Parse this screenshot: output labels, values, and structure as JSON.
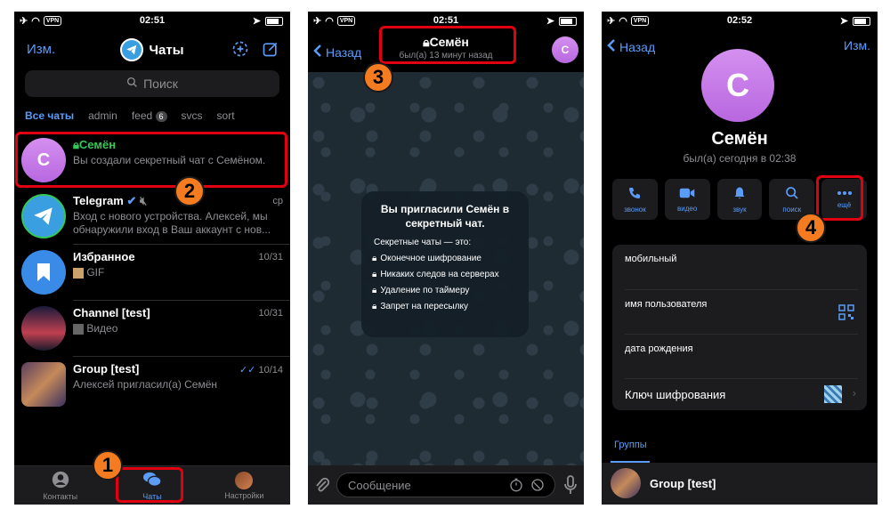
{
  "screens": [
    {
      "status": {
        "time": "02:51",
        "vpn": "VPN"
      },
      "header": {
        "edit_label": "Изм.",
        "title": "Чаты"
      },
      "search": {
        "placeholder": "Поиск"
      },
      "folders": [
        {
          "label": "Все чаты"
        },
        {
          "label": "admin"
        },
        {
          "label": "feed",
          "badge": "6"
        },
        {
          "label": "svcs"
        },
        {
          "label": "sort"
        }
      ],
      "chats": [
        {
          "name": "Семён",
          "date": "",
          "message": "Вы создали секретный чат с Семёном.",
          "avatar_letter": "С",
          "secret": true
        },
        {
          "name": "Telegram",
          "date": "ср",
          "message": "Вход с нового устройства. Алексей, мы обнаружили вход в Ваш аккаунт с нов...",
          "avatar_letter": "",
          "secret": false
        },
        {
          "name": "Избранное",
          "date": "10/31",
          "message": "GIF",
          "avatar_letter": "",
          "secret": false
        },
        {
          "name": "Channel [test]",
          "date": "10/31",
          "message": "Видео",
          "avatar_letter": "",
          "secret": false
        },
        {
          "name": "Group [test]",
          "date": "10/14",
          "message": "Алексей пригласил(а) Семён",
          "avatar_letter": "",
          "secret": false
        }
      ],
      "tabs": [
        {
          "label": "Контакты"
        },
        {
          "label": "Чаты"
        },
        {
          "label": "Настройки"
        }
      ]
    },
    {
      "status": {
        "time": "02:51",
        "vpn": "VPN"
      },
      "header": {
        "back_label": "Назад",
        "title": "Семён",
        "subtitle": "был(а) 13 минут назад",
        "avatar_letter": "С"
      },
      "secret_card": {
        "title": "Вы пригласили Семён в секретный чат.",
        "subtitle": "Секретные чаты — это:",
        "items": [
          "Оконечное шифрование",
          "Никаких следов на серверах",
          "Удаление по таймеру",
          "Запрет на пересылку"
        ]
      },
      "composer": {
        "placeholder": "Сообщение"
      }
    },
    {
      "status": {
        "time": "02:52",
        "vpn": "VPN"
      },
      "header": {
        "back_label": "Назад",
        "edit_label": "Изм."
      },
      "profile": {
        "avatar_letter": "С",
        "name": "Семён",
        "last_seen": "был(а) сегодня в 02:38"
      },
      "actions": [
        {
          "label": "звонок",
          "icon": "phone-icon"
        },
        {
          "label": "видео",
          "icon": "video-icon"
        },
        {
          "label": "звук",
          "icon": "bell-icon"
        },
        {
          "label": "поиск",
          "icon": "search-icon"
        },
        {
          "label": "ещё",
          "icon": "more-icon"
        }
      ],
      "info": [
        {
          "label": "мобильный"
        },
        {
          "label": "имя пользователя"
        },
        {
          "label": "дата рождения"
        },
        {
          "label": "Ключ шифрования"
        }
      ],
      "groups_tab": "Группы",
      "group": {
        "name": "Group [test]"
      }
    }
  ],
  "markers": [
    "1",
    "2",
    "3",
    "4"
  ],
  "colors": {
    "accent": "#5a9cf8",
    "highlight": "#e00012",
    "marker": "#f47b20",
    "avatar": "#c77be8"
  }
}
